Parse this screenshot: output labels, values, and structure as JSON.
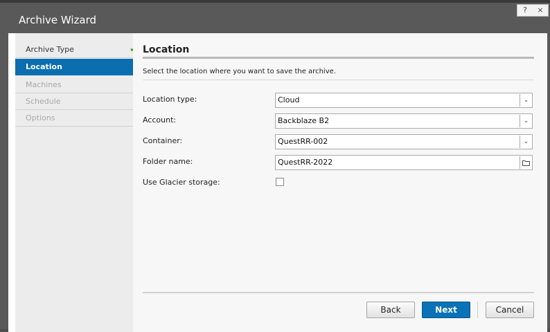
{
  "window": {
    "title": "Archive Wizard",
    "help_label": "?",
    "close_label": "×"
  },
  "steps": [
    {
      "label": "Archive Type",
      "state": "done",
      "check": "✔"
    },
    {
      "label": "Location",
      "state": "active"
    },
    {
      "label": "Machines",
      "state": "disabled"
    },
    {
      "label": "Schedule",
      "state": "disabled"
    },
    {
      "label": "Options",
      "state": "disabled"
    }
  ],
  "section": {
    "title": "Location",
    "description": "Select the location where you want to save the archive."
  },
  "form": {
    "location_type": {
      "label": "Location type:",
      "value": "Cloud"
    },
    "account": {
      "label": "Account:",
      "value": "Backblaze B2"
    },
    "container": {
      "label": "Container:",
      "value": "QuestRR-002"
    },
    "folder_name": {
      "label": "Folder name:",
      "value": "QuestRR-2022"
    },
    "glacier": {
      "label": "Use Glacier storage:",
      "checked": false
    }
  },
  "buttons": {
    "back": "Back",
    "next": "Next",
    "cancel": "Cancel"
  },
  "colors": {
    "accent": "#0a6eb0",
    "check": "#4a9a2b"
  }
}
